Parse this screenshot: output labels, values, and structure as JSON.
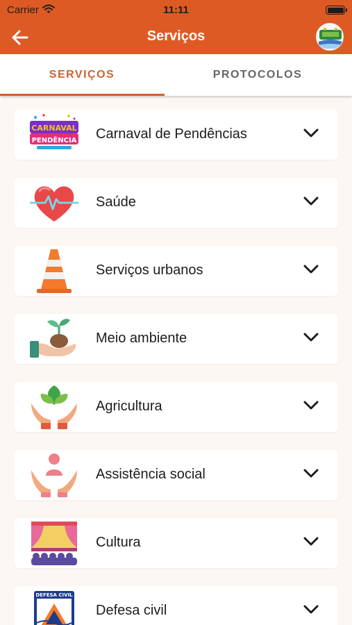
{
  "status_bar": {
    "carrier": "Carrier",
    "time": "11:11"
  },
  "app_bar": {
    "title": "Serviços"
  },
  "tabs": [
    {
      "label": "SERVIÇOS",
      "active": true
    },
    {
      "label": "PROTOCOLOS",
      "active": false
    }
  ],
  "services": [
    {
      "label": "Carnaval de Pendências",
      "icon": "carnaval-logo-icon",
      "logo_text": [
        "CARNAVAL",
        "PENDÊNCIA"
      ]
    },
    {
      "label": "Saúde",
      "icon": "heart-pulse-icon"
    },
    {
      "label": "Serviços urbanos",
      "icon": "traffic-cone-icon"
    },
    {
      "label": "Meio ambiente",
      "icon": "sprout-hand-icon"
    },
    {
      "label": "Agricultura",
      "icon": "leaf-hands-icon"
    },
    {
      "label": "Assistência social",
      "icon": "person-hands-icon"
    },
    {
      "label": "Cultura",
      "icon": "theater-icon"
    },
    {
      "label": "Defesa civil",
      "icon": "civil-defense-icon",
      "logo_text": [
        "DEFESA CIVIL"
      ]
    }
  ],
  "colors": {
    "primary": "#de5a24",
    "tab_active": "#c9642f",
    "background": "#fdf7f3"
  }
}
